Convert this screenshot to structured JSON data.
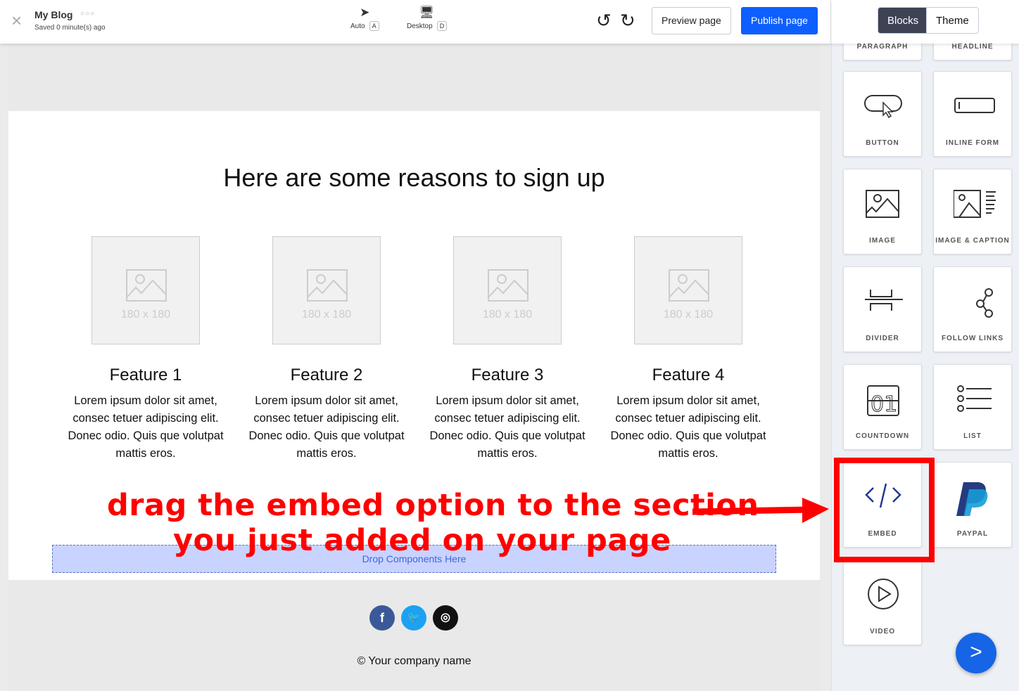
{
  "header": {
    "title": "My Blog",
    "status": "Saved 0 minute(s) ago",
    "modes": [
      {
        "label": "Auto",
        "key": "A"
      },
      {
        "label": "Desktop",
        "key": "D"
      }
    ],
    "preview": "Preview page",
    "publish": "Publish page"
  },
  "panel": {
    "tabs": [
      "Blocks",
      "Theme"
    ],
    "active_tab": "Blocks",
    "blocks": [
      "PARAGRAPH",
      "HEADLINE",
      "BUTTON",
      "INLINE FORM",
      "IMAGE",
      "IMAGE & CAPTION",
      "DIVIDER",
      "FOLLOW LINKS",
      "COUNTDOWN",
      "LIST",
      "EMBED",
      "PAYPAL",
      "VIDEO"
    ]
  },
  "page": {
    "heading": "Here are some reasons to sign up",
    "placeholder": "180 x 180",
    "features": [
      {
        "title": "Feature 1",
        "text": "Lorem ipsum dolor sit amet, consec tetuer adipiscing elit. Donec odio. Quis que volutpat mattis eros."
      },
      {
        "title": "Feature 2",
        "text": "Lorem ipsum dolor sit amet, consec tetuer adipiscing elit. Donec odio. Quis que volutpat mattis eros."
      },
      {
        "title": "Feature 3",
        "text": "Lorem ipsum dolor sit amet, consec tetuer adipiscing elit. Donec odio. Quis que volutpat mattis eros."
      },
      {
        "title": "Feature 4",
        "text": "Lorem ipsum dolor sit amet, consec tetuer adipiscing elit. Donec odio. Quis que volutpat mattis eros."
      }
    ],
    "drop": "Drop Components Here",
    "footer": "© Your company name",
    "social": [
      "facebook",
      "twitter",
      "instagram"
    ]
  },
  "annotation": {
    "line1": "drag the embed option to the section",
    "line2": "you just added on your page",
    "color": "#ff0000"
  }
}
